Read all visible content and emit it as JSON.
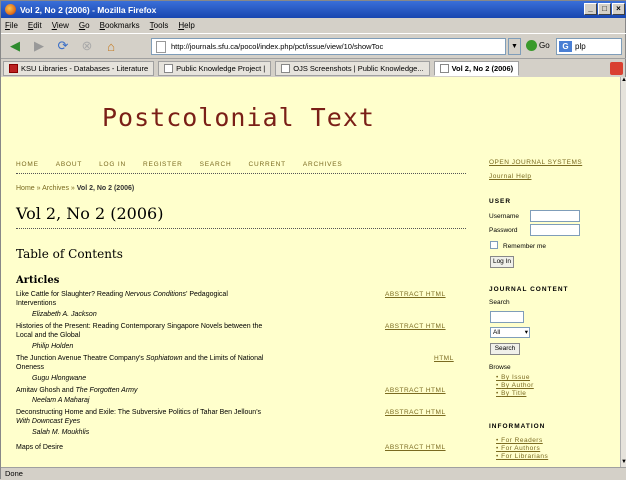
{
  "window": {
    "title": "Vol 2, No 2 (2006) - Mozilla Firefox",
    "buttons": [
      "_",
      "□",
      "×"
    ]
  },
  "menu": [
    "File",
    "Edit",
    "View",
    "Go",
    "Bookmarks",
    "Tools",
    "Help"
  ],
  "nav": {
    "url": "http://journals.sfu.ca/pocol/index.php/pct/issue/view/10/showToc",
    "go_label": "Go",
    "search_value": "plp"
  },
  "tabs": [
    "KSU Libraries - Databases - Literature",
    "Public Knowledge Project |",
    "OJS Screenshots | Public Knowledge...",
    "Vol 2, No 2 (2006)"
  ],
  "status": "Done",
  "site": {
    "title": "Postcolonial Text"
  },
  "topnav": [
    "HOME",
    "ABOUT",
    "LOG IN",
    "REGISTER",
    "SEARCH",
    "CURRENT",
    "ARCHIVES"
  ],
  "breadcrumb": {
    "home": "Home",
    "sep1": "»",
    "archives": "Archives",
    "sep2": "»",
    "current": "Vol 2, No 2 (2006)"
  },
  "issue_title": "Vol 2, No 2 (2006)",
  "toc_heading": "Table of Contents",
  "section": "Articles",
  "articles": [
    {
      "line1": "Like Cattle for Slaughter? Reading ",
      "ital": "Nervous Conditions",
      "line1b": "' Pedagogical",
      "line2": "Interventions",
      "author": "Elizabeth A. Jackson",
      "links": "ABSTRACT HTML"
    },
    {
      "line1": "Histories of the Present: Reading Contemporary Singapore Novels between the",
      "line2": "Local and the Global",
      "author": "Philip Holden",
      "links": "ABSTRACT HTML"
    },
    {
      "line1": "The Junction Avenue Theatre Company's ",
      "ital": "Sophiatown",
      "line1b": " and the Limits of National",
      "line2": "Oneness",
      "author": "Gugu Hlongwane",
      "links": "HTML"
    },
    {
      "line1": "Amitav Ghosh and ",
      "ital": "The Forgotten Army",
      "line1b": "",
      "line2": "",
      "author": "Neelam A Maharaj",
      "links": "ABSTRACT HTML"
    },
    {
      "line1": "Deconstructing Home and Exile: The Subversive Politics of Tahar Ben Jelloun's",
      "line2": "With Downcast Eyes",
      "author": "Salah M. Moukhlis",
      "links": "ABSTRACT HTML"
    },
    {
      "line1": "Maps of Desire",
      "line2": "",
      "author": "",
      "links": "ABSTRACT HTML"
    }
  ],
  "sidebar": {
    "ojs_link": "OPEN JOURNAL SYSTEMS",
    "help_link": "Journal Help",
    "user_head": "USER",
    "username_label": "Username",
    "password_label": "Password",
    "remember": "Remember me",
    "login_btn": "Log In",
    "content_head": "JOURNAL CONTENT",
    "search_label": "Search",
    "scope": "All",
    "search_btn": "Search",
    "browse": "Browse",
    "browse_items": [
      "By Issue",
      "By Author",
      "By Title"
    ],
    "info_head": "INFORMATION",
    "info_items": [
      "For Readers",
      "For Authors",
      "For Librarians"
    ]
  }
}
